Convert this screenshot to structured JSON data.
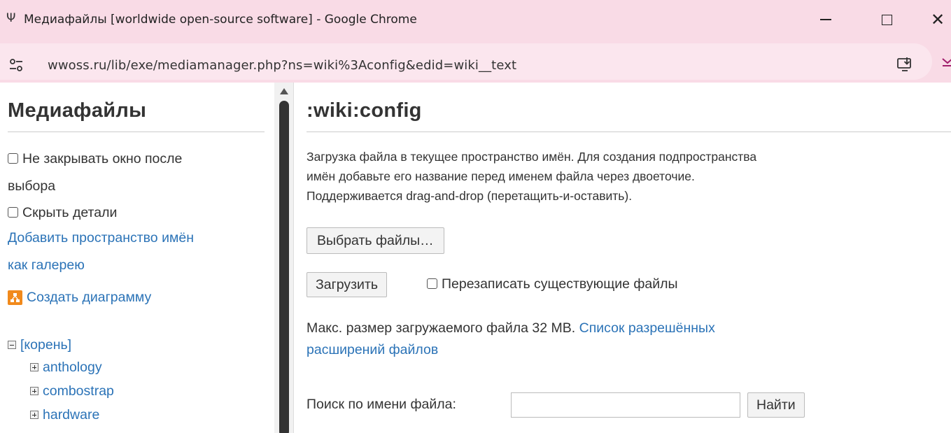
{
  "window": {
    "app_icon_glyph": "Ψ",
    "title": "Медиафайлы [worldwide open-source software] - Google Chrome",
    "minimize_icon": "minimize-icon",
    "maximize_icon": "maximize-icon",
    "close_glyph": "✕"
  },
  "addressbar": {
    "url": "wwoss.ru/lib/exe/mediamanager.php?ns=wiki%3Aconfig&edid=wiki__text",
    "site_info_icon": "tune-icon",
    "install_icon": "install-app-icon"
  },
  "left_panel": {
    "title": "Медиафайлы",
    "options": [
      {
        "label": "Не закрывать окно после",
        "label_cont": "выбора",
        "checked": false
      },
      {
        "label": "Скрыть детали",
        "checked": false
      }
    ],
    "add_namespace_link_1": "Добавить пространство имён",
    "add_namespace_link_2": "как галерею",
    "create_diagram": "Создать диаграмму",
    "tree": {
      "root": "[корень]",
      "children": [
        "anthology",
        "combostrap",
        "hardware"
      ]
    }
  },
  "right_panel": {
    "namespace_title": ":wiki:config",
    "intro_line_1": "Загрузка файла в текущее пространство имён. Для создания подпространства",
    "intro_line_2": "имён добавьте его название перед именем файла через двоеточие.",
    "intro_line_3": "Поддерживается drag-and-drop (перетащить-и-оставить).",
    "choose_files_button": "Выбрать файлы…",
    "upload_button": "Загрузить",
    "overwrite_label": "Перезаписать существующие файлы",
    "overwrite_checked": false,
    "max_size_text": "Макс. размер загружаемого файла 32 MB.",
    "allowed_ext_link_1": "Список разрешённых",
    "allowed_ext_link_2": "расширений файлов",
    "search_label": "Поиск по имени файла:",
    "search_value": "",
    "search_button": "Найти"
  },
  "colors": {
    "titlebar_bg": "#f9dbe6",
    "link": "#2b73b7",
    "diagram_icon": "#f18a1c"
  }
}
